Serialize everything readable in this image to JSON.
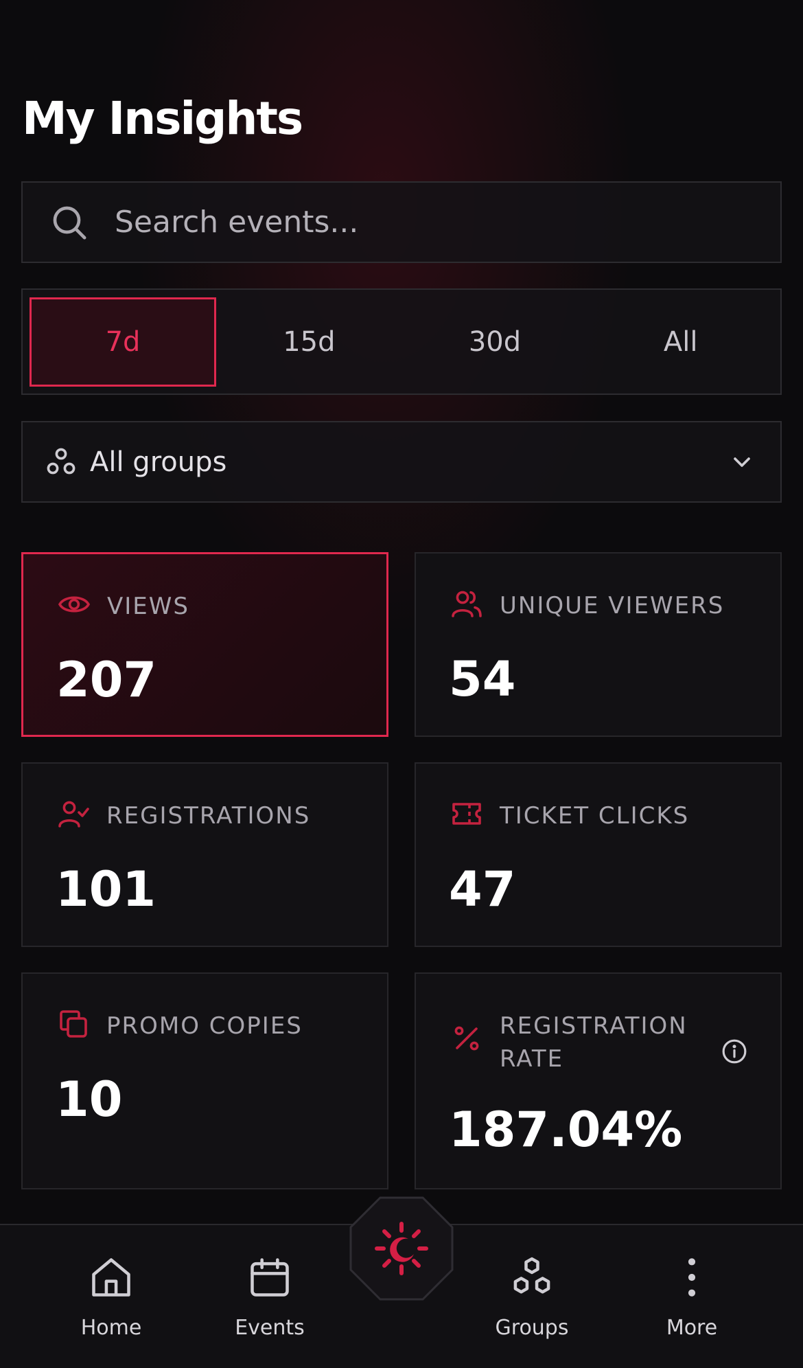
{
  "page": {
    "title": "My Insights"
  },
  "search": {
    "placeholder": "Search events..."
  },
  "range": {
    "options": [
      "7d",
      "15d",
      "30d",
      "All"
    ],
    "selected": "7d"
  },
  "groups": {
    "label": "All groups"
  },
  "metrics": [
    {
      "label": "VIEWS",
      "value": "207",
      "icon": "eye-icon",
      "highlight": true
    },
    {
      "label": "UNIQUE VIEWERS",
      "value": "54",
      "icon": "users-icon"
    },
    {
      "label": "REGISTRATIONS",
      "value": "101",
      "icon": "user-check-icon"
    },
    {
      "label": "TICKET CLICKS",
      "value": "47",
      "icon": "ticket-icon"
    },
    {
      "label": "PROMO COPIES",
      "value": "10",
      "icon": "copy-icon"
    },
    {
      "label": "REGISTRATION RATE",
      "value": "187.04%",
      "icon": "percent-icon"
    }
  ],
  "nav": [
    {
      "label": "Home",
      "icon": "home-icon"
    },
    {
      "label": "Events",
      "icon": "calendar-icon"
    },
    {
      "label": "Groups",
      "icon": "groups-icon"
    },
    {
      "label": "More",
      "icon": "more-vertical-icon"
    }
  ],
  "colors": {
    "accent": "#e0284e",
    "background": "#0c0b0d",
    "card": "#121114"
  }
}
